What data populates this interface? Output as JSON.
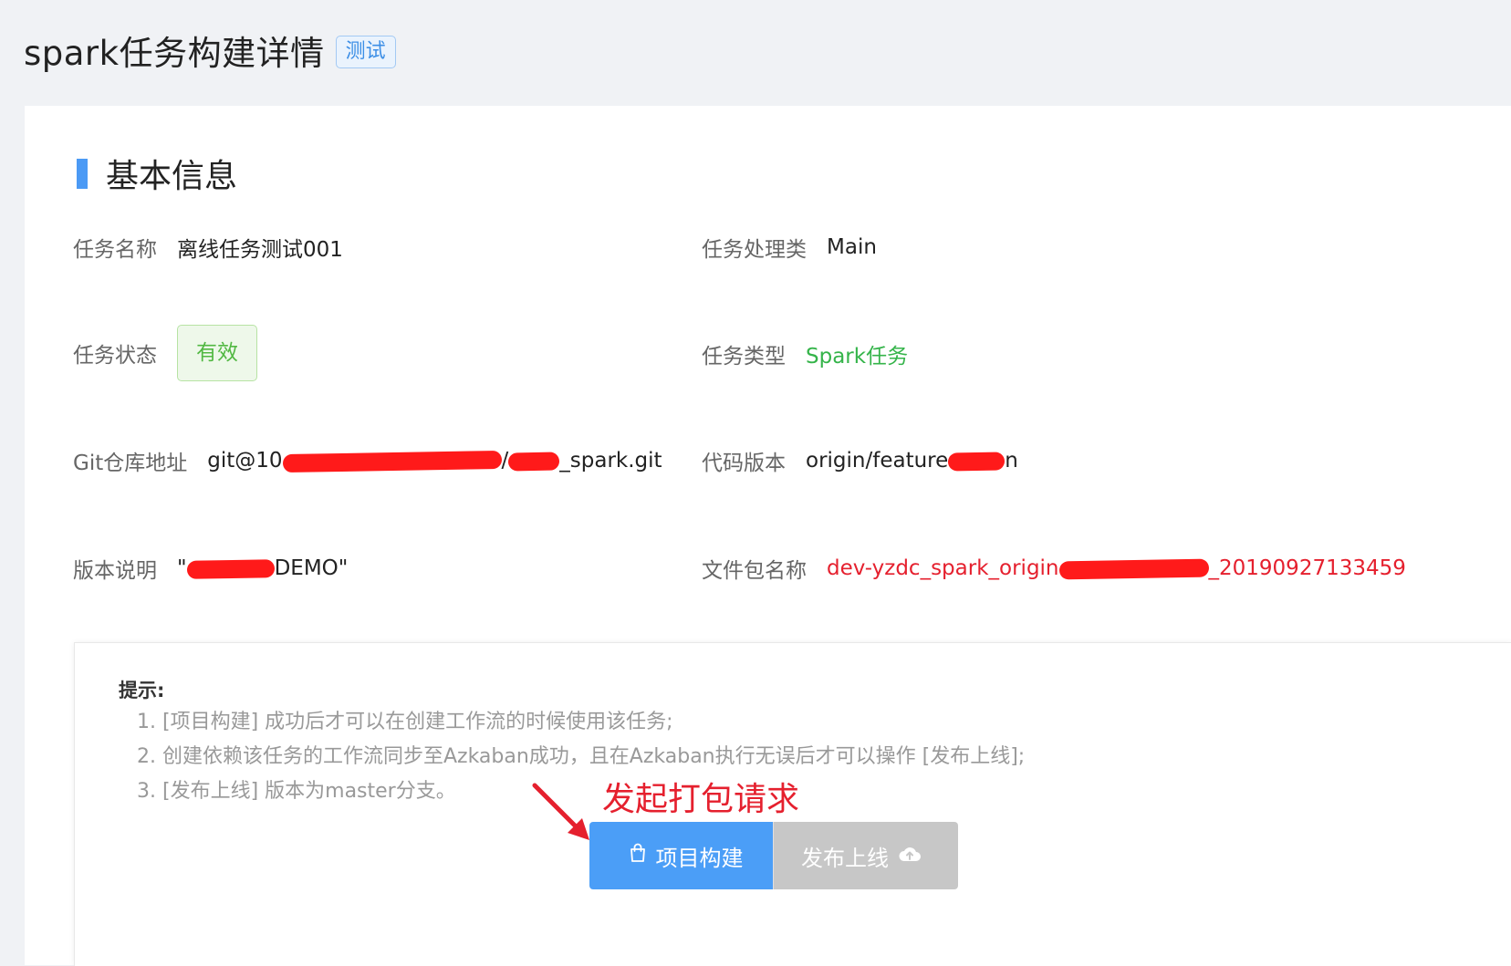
{
  "header": {
    "title": "spark任务构建详情",
    "env_tag": "测试"
  },
  "section": {
    "title": "基本信息"
  },
  "fields": {
    "task_name": {
      "label": "任务名称",
      "value": "离线任务测试001"
    },
    "handler_class": {
      "label": "任务处理类",
      "value": "Main"
    },
    "task_status": {
      "label": "任务状态",
      "value": "有效"
    },
    "task_type": {
      "label": "任务类型",
      "value": "Spark任务"
    },
    "git_repo": {
      "label": "Git仓库地址",
      "value_prefix": "git@10",
      "value_mid": "/",
      "value_suffix": "_spark.git"
    },
    "code_version": {
      "label": "代码版本",
      "value_prefix": "origin/feature",
      "value_suffix": "n"
    },
    "version_desc": {
      "label": "版本说明",
      "value_prefix": "\"",
      "value_suffix": "DEMO\""
    },
    "package_name": {
      "label": "文件包名称",
      "value_prefix": "dev-yzdc_spark_origin",
      "value_suffix": "_20190927133459"
    }
  },
  "tips": {
    "title": "提示:",
    "items": [
      "1. [项目构建] 成功后才可以在创建工作流的时候使用该任务;",
      "2. 创建依赖该任务的工作流同步至Azkaban成功，且在Azkaban执行无误后才可以操作 [发布上线];",
      "3. [发布上线] 版本为master分支。"
    ]
  },
  "annotation": "发起打包请求",
  "buttons": {
    "build_label": "项目构建",
    "release_label": "发布上线"
  },
  "colors": {
    "accent_blue": "#4b9ef7",
    "success_green": "#35b44a",
    "annotation_red": "#e5202e",
    "disabled_gray": "#c7c7c7"
  },
  "icons": {
    "build": "shopping-bag-icon",
    "release": "cloud-upload-icon"
  }
}
